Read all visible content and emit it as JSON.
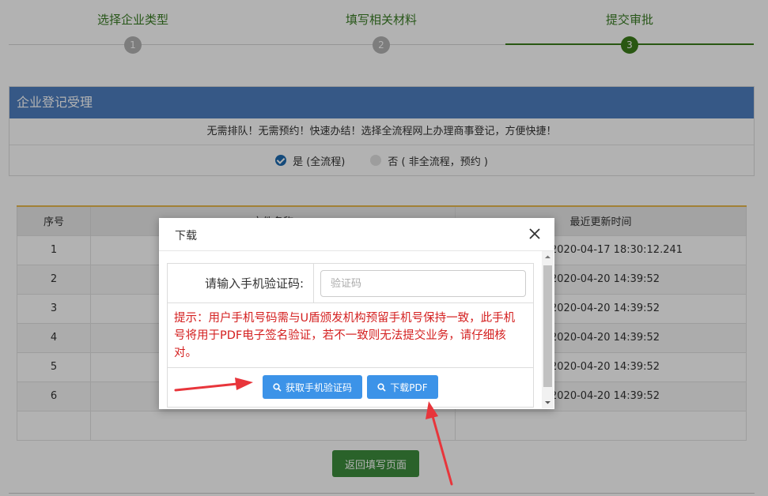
{
  "steps": [
    {
      "label": "选择企业类型",
      "num": "1"
    },
    {
      "label": "填写相关材料",
      "num": "2"
    },
    {
      "label": "提交审批",
      "num": "3"
    }
  ],
  "panel": {
    "title": "企业登记受理",
    "desc": "无需排队！无需预约！快速办结！选择全流程网上办理商事登记，方便快捷！",
    "option_yes": "是 (全流程)",
    "option_no": "否 ( 非全流程，预约 )"
  },
  "table": {
    "headers": [
      "序号",
      "文件名称",
      "最近更新时间"
    ],
    "rows": [
      {
        "num": "1",
        "time": "2020-04-17 18:30:12.241"
      },
      {
        "num": "2",
        "time": "2020-04-20 14:39:52"
      },
      {
        "num": "3",
        "time": "2020-04-20 14:39:52"
      },
      {
        "num": "4",
        "time": "2020-04-20 14:39:52"
      },
      {
        "num": "5",
        "time": "2020-04-20 14:39:52"
      },
      {
        "num": "6",
        "time": "2020-04-20 14:39:52"
      }
    ]
  },
  "back_button": "返回填写页面",
  "modal": {
    "title": "下载",
    "label": "请输入手机验证码:",
    "placeholder": "验证码",
    "tip": "提示：用户手机号码需与U盾颁发机构预留手机号保持一致，此手机号将用于PDF电子签名验证，若不一致则无法提交业务，请仔细核对。",
    "btn_get_code": "获取手机验证码",
    "btn_download": "下载PDF"
  },
  "colors": {
    "step_active": "#3b7d1a",
    "panel_header": "#4e7fc1",
    "primary_button": "#3c93e8",
    "tip_text": "#d42020",
    "arrow": "#e8353b"
  }
}
